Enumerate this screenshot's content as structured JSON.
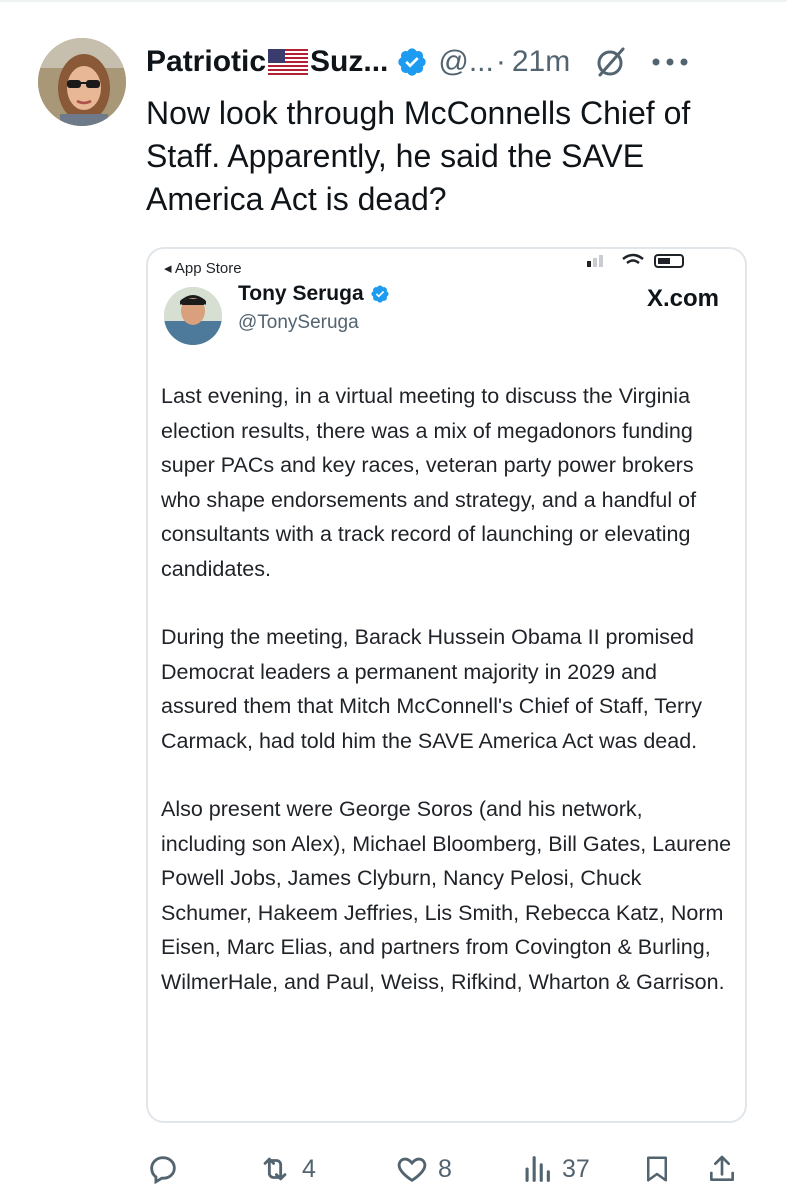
{
  "tweet": {
    "display_name_start": "Patriotic",
    "display_name_end": "Suz...",
    "handle": "@...",
    "separator": "·",
    "time": "21m",
    "text": "Now look through McConnells Chief of Staff. Apparently, he said the SAVE America Act is dead?"
  },
  "embedded": {
    "back_label": "◂ App Store",
    "author_name": "Tony Seruga",
    "author_handle": "@TonySeruga",
    "brand": "X.com",
    "paragraphs": [
      "Last evening, in a virtual meeting to discuss the Virginia election results, there was a mix of megadonors funding super PACs and key races, veteran party power brokers who shape endorsements and strategy, and a handful of consultants with a track record of launching or elevating candidates.",
      "During the meeting, Barack Hussein Obama II promised Democrat leaders a permanent majority in 2029 and assured them that Mitch McConnell's Chief of Staff, Terry Carmack, had told him the SAVE America Act was dead.",
      "Also present were George Soros (and his network, including son Alex), Michael Bloomberg, Bill Gates, Laurene Powell Jobs, James Clyburn, Nancy Pelosi, Chuck Schumer, Hakeem Jeffries, Lis Smith, Rebecca Katz, Norm Eisen, Marc Elias, and partners from Covington & Burling, WilmerHale, and Paul, Weiss, Rifkind, Wharton & Garrison."
    ]
  },
  "actions": {
    "reposts": "4",
    "likes": "8",
    "views": "37"
  },
  "colors": {
    "verified": "#1d9bf0",
    "muted": "#536471",
    "text": "#0f1419"
  }
}
